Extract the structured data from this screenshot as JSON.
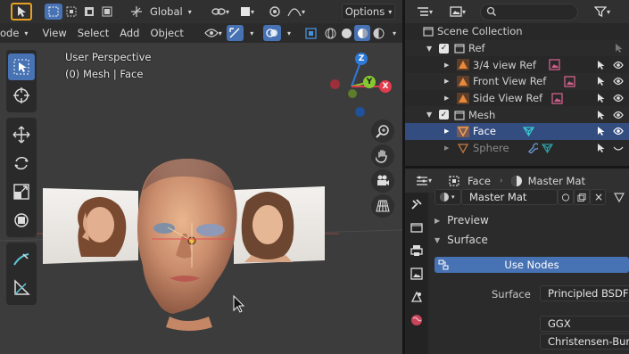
{
  "viewport": {
    "mode_label": "ode",
    "menu": {
      "view": "View",
      "select": "Select",
      "add": "Add",
      "object": "Object"
    },
    "transform_orientation": "Global",
    "options_label": "Options",
    "overlay": {
      "perspective": "User Perspective",
      "object_info": "(0) Mesh | Face"
    },
    "gizmo": {
      "z": "Z",
      "y": "Y",
      "x": "X"
    },
    "colors": {
      "x_axis": "#e23c4e",
      "y_axis": "#86c832",
      "z_axis": "#2e7ad8",
      "active": "#4772b3"
    }
  },
  "outliner": {
    "search_placeholder": "",
    "rows": [
      {
        "label": "Scene Collection"
      },
      {
        "label": "Ref"
      },
      {
        "label": "3/4 view Ref"
      },
      {
        "label": "Front View Ref"
      },
      {
        "label": "Side View Ref"
      },
      {
        "label": "Mesh"
      },
      {
        "label": "Face"
      },
      {
        "label": "Sphere"
      }
    ]
  },
  "properties": {
    "breadcrumb_object": "Face",
    "breadcrumb_material": "Master Mat",
    "material_name": "Master Mat",
    "panels": {
      "preview": "Preview",
      "surface": "Surface"
    },
    "use_nodes": "Use Nodes",
    "surface_label": "Surface",
    "surface_value": "Principled BSDF",
    "distribution": "GGX",
    "subsurface_method": "Christensen-Burl..."
  }
}
